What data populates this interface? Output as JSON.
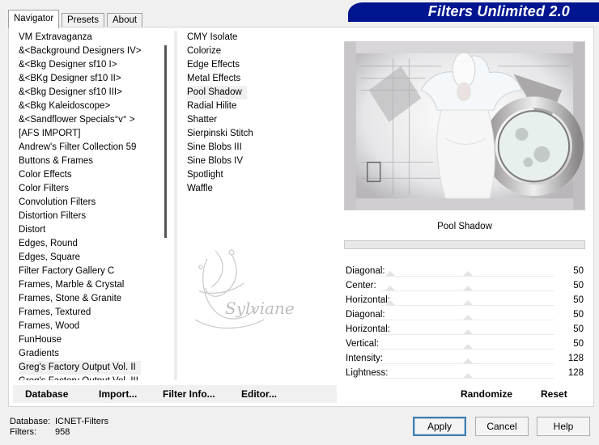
{
  "tabs": [
    {
      "label": "Navigator"
    },
    {
      "label": "Presets"
    },
    {
      "label": "About"
    }
  ],
  "banner": {
    "title": "Filters Unlimited 2.0"
  },
  "categories": [
    " VM Extravaganza",
    "&<Background Designers IV>",
    "&<Bkg Designer sf10 I>",
    "&<BKg Designer sf10 II>",
    "&<Bkg Designer sf10 III>",
    "&<Bkg Kaleidoscope>",
    "&<Sandflower Specials°v° >",
    "[AFS IMPORT]",
    "Andrew's Filter Collection 59",
    "Buttons & Frames",
    "Color Effects",
    "Color Filters",
    "Convolution Filters",
    "Distortion Filters",
    "Distort",
    "Edges, Round",
    "Edges, Square",
    "Filter Factory Gallery C",
    "Frames, Marble & Crystal",
    "Frames, Stone & Granite",
    "Frames, Textured",
    "Frames, Wood",
    "FunHouse",
    "Gradients",
    "Greg's Factory Output Vol. II",
    "Greg's Factory Output Vol. III"
  ],
  "selected_category": "Greg's Factory Output Vol. II",
  "filters": [
    "CMY Isolate",
    "Colorize",
    "Edge Effects",
    "Metal Effects",
    "Pool Shadow",
    "Radial Hilite",
    "Shatter",
    "Sierpinski Stitch",
    "Sine Blobs III",
    "Sine Blobs IV",
    "Spotlight",
    "Waffle"
  ],
  "selected_filter": "Pool Shadow",
  "watermark_text": "Sylviane",
  "current_filter": "Pool Shadow",
  "params": [
    {
      "label": "Diagonal:",
      "value": "50",
      "fraction": 0.5
    },
    {
      "label": "Center:",
      "value": "50",
      "fraction": 0.5
    },
    {
      "label": "Horizontal:",
      "value": "50",
      "fraction": 0.5
    },
    {
      "label": "Diagonal:",
      "value": "50",
      "fraction": 0.5
    },
    {
      "label": "Horizontal:",
      "value": "50",
      "fraction": 0.5
    },
    {
      "label": "Vertical:",
      "value": "50",
      "fraction": 0.5
    },
    {
      "label": "Intensity:",
      "value": "128",
      "fraction": 0.5
    },
    {
      "label": "Lightness:",
      "value": "128",
      "fraction": 0.5
    }
  ],
  "toolbar": {
    "database": "Database",
    "import": "Import...",
    "filter_info": "Filter Info...",
    "editor": "Editor...",
    "randomize": "Randomize",
    "reset": "Reset"
  },
  "info": {
    "database_label": "Database:",
    "database_value": "ICNET-Filters",
    "filters_label": "Filters:",
    "filters_value": "958"
  },
  "buttons": {
    "apply": "Apply",
    "cancel": "Cancel",
    "help": "Help"
  },
  "colors": {
    "banner": "#00158f",
    "default_button_border": "#3c7fb1"
  }
}
